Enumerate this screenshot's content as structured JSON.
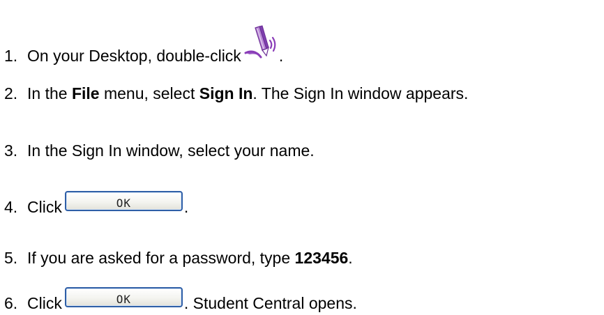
{
  "steps": [
    {
      "num": "1.",
      "text_before": "On your Desktop, double-click",
      "icon": "pen-sound-icon",
      "text_after": "."
    },
    {
      "num": "2.",
      "parts": [
        "In the ",
        "File",
        " menu, select ",
        "Sign In",
        ". The Sign In window appears."
      ]
    },
    {
      "num": "3.",
      "text": "In the Sign In window, select your name."
    },
    {
      "num": "4.",
      "text_before": "Click",
      "button_label": "OK",
      "text_after": "."
    },
    {
      "num": "5.",
      "text_before": "If you are asked for a password, type ",
      "bold": "123456",
      "text_after": "."
    },
    {
      "num": "6.",
      "text_before": "Click",
      "button_label": "OK",
      "text_after": ". Student Central opens."
    }
  ],
  "colors": {
    "button_border": "#2f5fa7",
    "icon_purple": "#8a3db8"
  }
}
